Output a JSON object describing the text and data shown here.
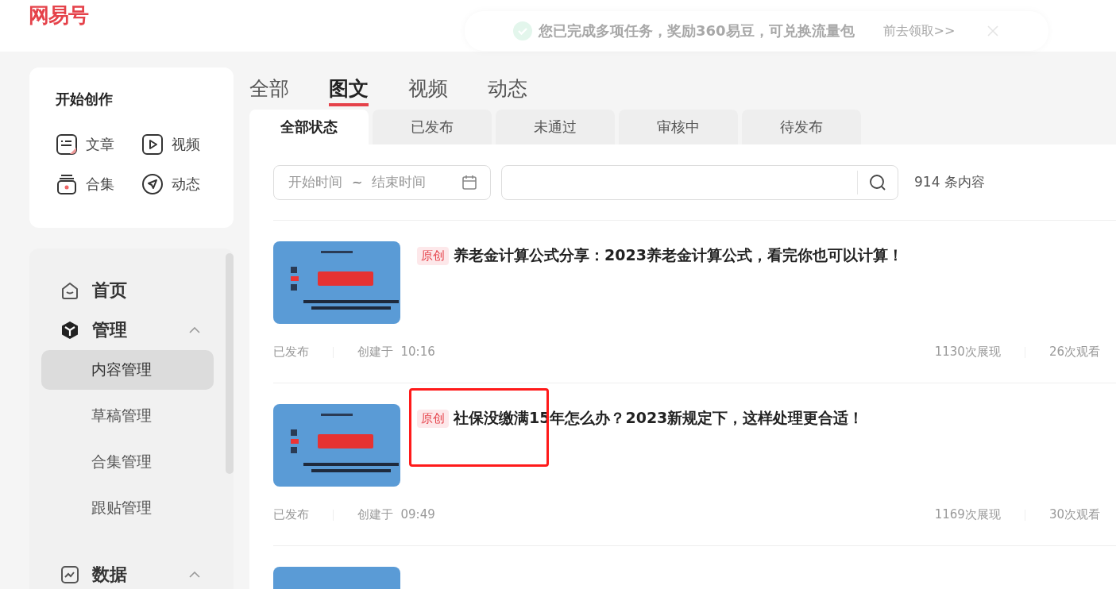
{
  "logo": {
    "text": "网易号"
  },
  "toast": {
    "message": "您已完成多项任务，奖励360易豆，可兑换流量包",
    "link": "前去领取>>"
  },
  "create": {
    "title": "开始创作",
    "items": [
      {
        "label": "文章",
        "kind": "article"
      },
      {
        "label": "视频",
        "kind": "video"
      },
      {
        "label": "合集",
        "kind": "collection"
      },
      {
        "label": "动态",
        "kind": "moment"
      }
    ]
  },
  "nav": [
    {
      "label": "首页",
      "kind": "home",
      "expanded": false
    },
    {
      "label": "管理",
      "kind": "manage",
      "expanded": true,
      "children": [
        {
          "label": "内容管理",
          "selected": true
        },
        {
          "label": "草稿管理",
          "selected": false
        },
        {
          "label": "合集管理",
          "selected": false
        },
        {
          "label": "跟贴管理",
          "selected": false
        }
      ]
    },
    {
      "label": "数据",
      "kind": "data",
      "expanded": true
    }
  ],
  "type_tabs": [
    {
      "label": "全部",
      "selected": false
    },
    {
      "label": "图文",
      "selected": true
    },
    {
      "label": "视频",
      "selected": false
    },
    {
      "label": "动态",
      "selected": false
    }
  ],
  "status_tabs": [
    {
      "label": "全部状态",
      "selected": true
    },
    {
      "label": "已发布",
      "selected": false
    },
    {
      "label": "未通过",
      "selected": false
    },
    {
      "label": "审核中",
      "selected": false
    },
    {
      "label": "待发布",
      "selected": false
    }
  ],
  "filters": {
    "start_placeholder": "开始时间",
    "separator": "~",
    "end_placeholder": "结束时间",
    "count": "914 条内容"
  },
  "articles": [
    {
      "badge": "原创",
      "title": "养老金计算公式分享：2023养老金计算公式，看完你也可以计算！",
      "status": "已发布",
      "created": "创建于  10:16",
      "impressions": "1130次展现",
      "views": "26次观看",
      "highlighted": false
    },
    {
      "badge": "原创",
      "title": "社保没缴满15年怎么办？2023新规定下，这样处理更合适！",
      "status": "已发布",
      "created": "创建于  09:49",
      "impressions": "1169次展现",
      "views": "30次观看",
      "highlighted": true
    },
    {
      "kind": "picture"
    }
  ]
}
